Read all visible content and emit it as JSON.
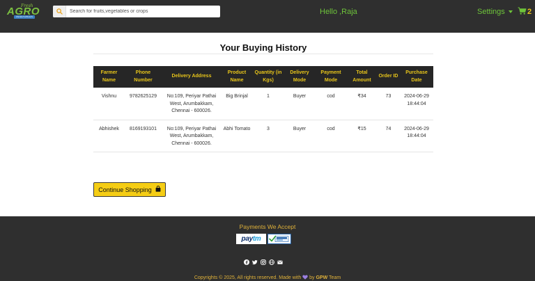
{
  "brand": {
    "logo_top": "Fresh",
    "logo_main": "AGRO",
    "logo_strip": "VEGETABLES"
  },
  "header": {
    "search_placeholder": "Search for fruits,vegetables or crops",
    "greeting": "Hello ,Raja",
    "settings_label": "Settings",
    "cart_count": "2"
  },
  "main": {
    "title": "Your Buying History",
    "columns": [
      "Farmer Name",
      "Phone Number",
      "Delivery Address",
      "Product Name",
      "Quantity (in Kgs)",
      "Delivery Mode",
      "Payment Mode",
      "Total Amount",
      "Order ID",
      "Purchase Date"
    ],
    "orders": [
      {
        "farmer": "Vishnu",
        "phone": "9782625129",
        "address": "No:109, Periyar Pathai West, Arumbakkam, Chennai - 600026.",
        "product": "Big Brinjal",
        "quantity": "1",
        "delivery": "Buyer",
        "payment": "cod",
        "total": "₹34",
        "order_id": "73",
        "date": "2024-06-29 18:44:04"
      },
      {
        "farmer": "Abhishek",
        "phone": "8169193101",
        "address": "No:109, Periyar Pathai West, Arumbakkam, Chennai - 600026.",
        "product": "Abhi Tomato",
        "quantity": "3",
        "delivery": "Buyer",
        "payment": "cod",
        "total": "₹15",
        "order_id": "74",
        "date": "2024-06-29 18:44:04"
      }
    ],
    "continue_label": "Continue Shopping"
  },
  "footer": {
    "payments_title": "Payments We Accept",
    "paytm_pay": "pay",
    "paytm_tm": "tm",
    "copyright_prefix": "Copyrights © 2025, All rights reserved. Made with",
    "copyright_by": "by",
    "team_name": "GPW",
    "team_suffix": "Team"
  },
  "colors": {
    "header_bg": "#2f2f2f",
    "accent_green": "#6ec43a",
    "accent_yellow": "#e8c51a",
    "table_header_bg": "#262626",
    "button_bg": "#f5cd14"
  },
  "icons": [
    "search-icon",
    "caret-down-icon",
    "cart-icon",
    "shopping-bag-icon",
    "facebook-icon",
    "twitter-icon",
    "instagram-icon",
    "globe-icon",
    "mail-icon",
    "heart-icon"
  ]
}
